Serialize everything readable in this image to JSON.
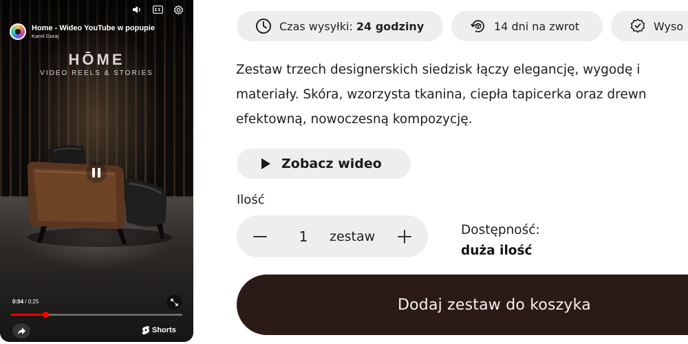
{
  "video": {
    "title": "Home - Wideo YouTube w popupie",
    "author": "Kamil Goraj",
    "brand_name": "HŌME",
    "brand_sub": "VIDEO REELS & STORIES",
    "current_time": "0:04",
    "duration": "0:25",
    "progress": 0.2,
    "shorts_label": "Shorts",
    "icons": [
      "volume-icon",
      "captions-icon",
      "settings-icon",
      "pause-icon",
      "expand-icon",
      "share-icon",
      "shorts-logo-icon"
    ],
    "progress_color": "#ff0000"
  },
  "features": [
    {
      "icon": "clock-icon",
      "prefix": "Czas wysyłki: ",
      "bold": "24 godziny"
    },
    {
      "icon": "return-box-icon",
      "prefix": "14 dni na zwrot",
      "bold": ""
    },
    {
      "icon": "quality-badge-icon",
      "prefix": "Wyso",
      "bold": ""
    }
  ],
  "description": {
    "lines": [
      "Zestaw trzech designerskich siedzisk łączy elegancję, wygodę i",
      "materiały. Skóra, wzorzysta tkanina, ciepła tapicerka oraz drewn",
      "efektowną, nowoczesną kompozycję."
    ]
  },
  "video_button": {
    "label": "Zobacz wideo"
  },
  "quantity": {
    "label": "Ilość",
    "value": "1",
    "unit": "zestaw",
    "minus": "−",
    "plus": "+"
  },
  "availability": {
    "label": "Dostępność:",
    "value": "duża ilość"
  },
  "cart_button": {
    "label": "Dodaj zestaw do koszyka"
  },
  "colors": {
    "cart_bg": "#2b1b17",
    "pill_bg": "#eeeeee",
    "text": "#1e1e1e"
  }
}
